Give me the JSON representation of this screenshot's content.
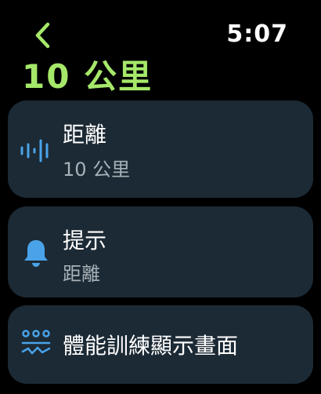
{
  "header": {
    "time": "5:07",
    "title": "10 公里"
  },
  "cards": [
    {
      "icon": "waveform-icon",
      "label": "距離",
      "sub": "10 公里"
    },
    {
      "icon": "bell-icon",
      "label": "提示",
      "sub": "距離"
    },
    {
      "icon": "workout-display-icon",
      "label": "體能訓練顯示畫面"
    }
  ],
  "colors": {
    "accent": "#a6e86a",
    "icon_blue": "#4aa3e8",
    "card_bg": "#1c2a35",
    "secondary_text": "#a8b1b8"
  }
}
